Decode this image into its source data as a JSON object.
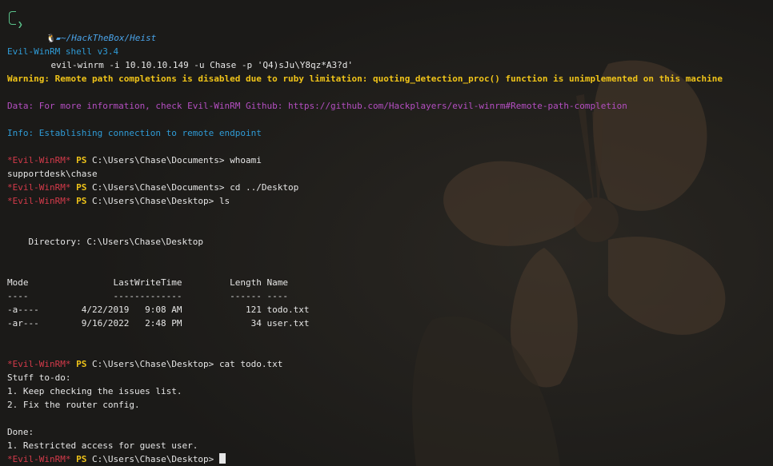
{
  "prompt": {
    "cwd": "~/HackTheBox/Heist",
    "command": "evil-winrm -i 10.10.10.149 -u Chase -p 'Q4)sJu\\Y8qz*A3?d'",
    "icons": [
      "linux-tux-icon",
      "folder-icon",
      "chevron-right-icon"
    ]
  },
  "banner": {
    "shell": "Evil-WinRM shell v3.4",
    "warning": "Warning: Remote path completions is disabled due to ruby limitation: quoting_detection_proc() function is unimplemented on this machine",
    "data": "Data: For more information, check Evil-WinRM Github: https://github.com/Hackplayers/evil-winrm#Remote-path-completion",
    "info": "Info: Establishing connection to remote endpoint"
  },
  "ps": {
    "tag": "*Evil-WinRM*",
    "ps_label": "PS"
  },
  "session": {
    "cmd1_path": "C:\\Users\\Chase\\Documents>",
    "cmd1": "whoami",
    "out1": "supportdesk\\chase",
    "cmd2_path": "C:\\Users\\Chase\\Documents>",
    "cmd2": "cd ../Desktop",
    "cmd3_path": "C:\\Users\\Chase\\Desktop>",
    "cmd3": "ls",
    "directory": "    Directory: C:\\Users\\Chase\\Desktop",
    "table": {
      "header": "Mode                LastWriteTime         Length Name",
      "rule": "----                -------------         ------ ----",
      "rows": [
        "-a----        4/22/2019   9:08 AM            121 todo.txt",
        "-ar---        9/16/2022   2:48 PM             34 user.txt"
      ]
    },
    "cmd4_path": "C:\\Users\\Chase\\Desktop>",
    "cmd4": "cat todo.txt",
    "todo": [
      "Stuff to-do:",
      "1. Keep checking the issues list.",
      "2. Fix the router config.",
      "",
      "Done:",
      "1. Restricted access for guest user."
    ],
    "cmd5_path": "C:\\Users\\Chase\\Desktop>"
  },
  "colors": {
    "background": "#1c1b19",
    "accent_green": "#5ac28a",
    "path_blue": "#4aa3e8",
    "info_blue": "#2f9bd6",
    "warning_yellow": "#f0c419",
    "data_purple": "#b54fc2",
    "winrm_red": "#d33a4a"
  }
}
